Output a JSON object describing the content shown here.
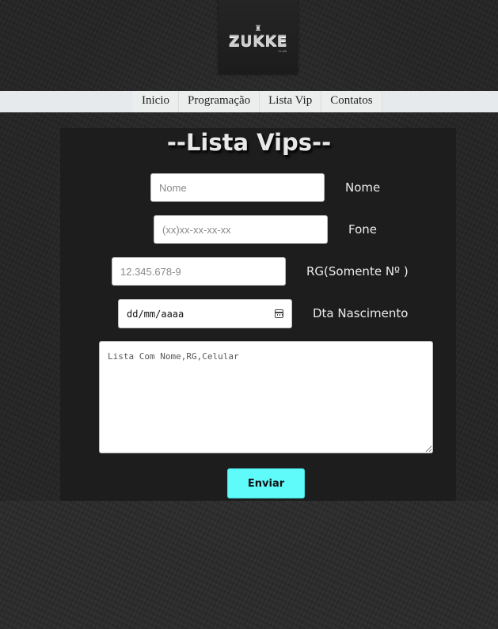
{
  "logo": {
    "brand": "ZUKKE",
    "sub": "CLUB",
    "mark": "♜"
  },
  "nav": [
    {
      "label": "Inicio"
    },
    {
      "label": "Programação"
    },
    {
      "label": "Lista Vip"
    },
    {
      "label": "Contatos"
    }
  ],
  "form": {
    "title": "--Lista Vips--",
    "name": {
      "placeholder": "Nome",
      "label": "Nome"
    },
    "phone": {
      "placeholder": "(xx)xx-xx-xx-xx",
      "label": "Fone"
    },
    "rg": {
      "placeholder": "12.345.678-9",
      "label": "RG(Somente Nº )"
    },
    "birth": {
      "placeholder": "dd/mm/aaaa",
      "label": "Dta Nascimento"
    },
    "list": {
      "placeholder": "Lista Com Nome,RG,Celular"
    },
    "submit_label": "Enviar"
  },
  "colors": {
    "accent": "#5ffbfb",
    "panel": "#1d1d1d",
    "navbar": "#e6eaec"
  }
}
